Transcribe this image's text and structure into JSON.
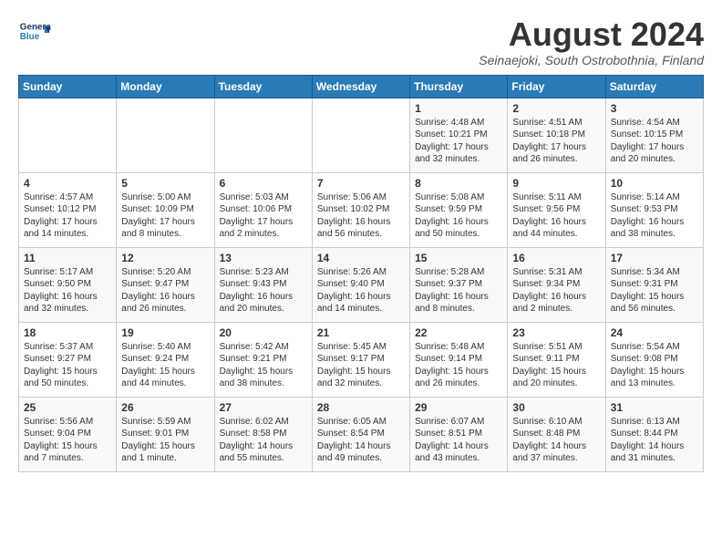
{
  "logo": {
    "line1": "General",
    "line2": "Blue"
  },
  "title": "August 2024",
  "location": "Seinaejoki, South Ostrobothnia, Finland",
  "days_header": [
    "Sunday",
    "Monday",
    "Tuesday",
    "Wednesday",
    "Thursday",
    "Friday",
    "Saturday"
  ],
  "weeks": [
    [
      {
        "day": "",
        "text": ""
      },
      {
        "day": "",
        "text": ""
      },
      {
        "day": "",
        "text": ""
      },
      {
        "day": "",
        "text": ""
      },
      {
        "day": "1",
        "text": "Sunrise: 4:48 AM\nSunset: 10:21 PM\nDaylight: 17 hours\nand 32 minutes."
      },
      {
        "day": "2",
        "text": "Sunrise: 4:51 AM\nSunset: 10:18 PM\nDaylight: 17 hours\nand 26 minutes."
      },
      {
        "day": "3",
        "text": "Sunrise: 4:54 AM\nSunset: 10:15 PM\nDaylight: 17 hours\nand 20 minutes."
      }
    ],
    [
      {
        "day": "4",
        "text": "Sunrise: 4:57 AM\nSunset: 10:12 PM\nDaylight: 17 hours\nand 14 minutes."
      },
      {
        "day": "5",
        "text": "Sunrise: 5:00 AM\nSunset: 10:09 PM\nDaylight: 17 hours\nand 8 minutes."
      },
      {
        "day": "6",
        "text": "Sunrise: 5:03 AM\nSunset: 10:06 PM\nDaylight: 17 hours\nand 2 minutes."
      },
      {
        "day": "7",
        "text": "Sunrise: 5:06 AM\nSunset: 10:02 PM\nDaylight: 16 hours\nand 56 minutes."
      },
      {
        "day": "8",
        "text": "Sunrise: 5:08 AM\nSunset: 9:59 PM\nDaylight: 16 hours\nand 50 minutes."
      },
      {
        "day": "9",
        "text": "Sunrise: 5:11 AM\nSunset: 9:56 PM\nDaylight: 16 hours\nand 44 minutes."
      },
      {
        "day": "10",
        "text": "Sunrise: 5:14 AM\nSunset: 9:53 PM\nDaylight: 16 hours\nand 38 minutes."
      }
    ],
    [
      {
        "day": "11",
        "text": "Sunrise: 5:17 AM\nSunset: 9:50 PM\nDaylight: 16 hours\nand 32 minutes."
      },
      {
        "day": "12",
        "text": "Sunrise: 5:20 AM\nSunset: 9:47 PM\nDaylight: 16 hours\nand 26 minutes."
      },
      {
        "day": "13",
        "text": "Sunrise: 5:23 AM\nSunset: 9:43 PM\nDaylight: 16 hours\nand 20 minutes."
      },
      {
        "day": "14",
        "text": "Sunrise: 5:26 AM\nSunset: 9:40 PM\nDaylight: 16 hours\nand 14 minutes."
      },
      {
        "day": "15",
        "text": "Sunrise: 5:28 AM\nSunset: 9:37 PM\nDaylight: 16 hours\nand 8 minutes."
      },
      {
        "day": "16",
        "text": "Sunrise: 5:31 AM\nSunset: 9:34 PM\nDaylight: 16 hours\nand 2 minutes."
      },
      {
        "day": "17",
        "text": "Sunrise: 5:34 AM\nSunset: 9:31 PM\nDaylight: 15 hours\nand 56 minutes."
      }
    ],
    [
      {
        "day": "18",
        "text": "Sunrise: 5:37 AM\nSunset: 9:27 PM\nDaylight: 15 hours\nand 50 minutes."
      },
      {
        "day": "19",
        "text": "Sunrise: 5:40 AM\nSunset: 9:24 PM\nDaylight: 15 hours\nand 44 minutes."
      },
      {
        "day": "20",
        "text": "Sunrise: 5:42 AM\nSunset: 9:21 PM\nDaylight: 15 hours\nand 38 minutes."
      },
      {
        "day": "21",
        "text": "Sunrise: 5:45 AM\nSunset: 9:17 PM\nDaylight: 15 hours\nand 32 minutes."
      },
      {
        "day": "22",
        "text": "Sunrise: 5:48 AM\nSunset: 9:14 PM\nDaylight: 15 hours\nand 26 minutes."
      },
      {
        "day": "23",
        "text": "Sunrise: 5:51 AM\nSunset: 9:11 PM\nDaylight: 15 hours\nand 20 minutes."
      },
      {
        "day": "24",
        "text": "Sunrise: 5:54 AM\nSunset: 9:08 PM\nDaylight: 15 hours\nand 13 minutes."
      }
    ],
    [
      {
        "day": "25",
        "text": "Sunrise: 5:56 AM\nSunset: 9:04 PM\nDaylight: 15 hours\nand 7 minutes."
      },
      {
        "day": "26",
        "text": "Sunrise: 5:59 AM\nSunset: 9:01 PM\nDaylight: 15 hours\nand 1 minute."
      },
      {
        "day": "27",
        "text": "Sunrise: 6:02 AM\nSunset: 8:58 PM\nDaylight: 14 hours\nand 55 minutes."
      },
      {
        "day": "28",
        "text": "Sunrise: 6:05 AM\nSunset: 8:54 PM\nDaylight: 14 hours\nand 49 minutes."
      },
      {
        "day": "29",
        "text": "Sunrise: 6:07 AM\nSunset: 8:51 PM\nDaylight: 14 hours\nand 43 minutes."
      },
      {
        "day": "30",
        "text": "Sunrise: 6:10 AM\nSunset: 8:48 PM\nDaylight: 14 hours\nand 37 minutes."
      },
      {
        "day": "31",
        "text": "Sunrise: 6:13 AM\nSunset: 8:44 PM\nDaylight: 14 hours\nand 31 minutes."
      }
    ]
  ]
}
